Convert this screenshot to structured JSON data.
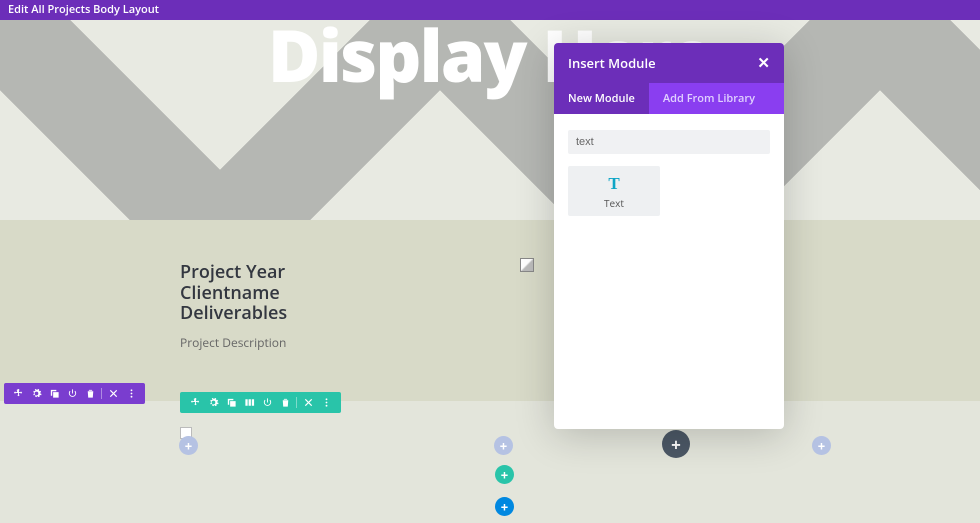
{
  "header": {
    "title": "Edit All Projects Body Layout"
  },
  "hero": {
    "title": "Display Here"
  },
  "info": {
    "line1": "Project Year",
    "line2": "Clientname",
    "line3": "Deliverables",
    "desc": "Project Description"
  },
  "modal": {
    "title": "Insert Module",
    "close": "✕",
    "tabs": {
      "new": "New Module",
      "lib": "Add From Library"
    },
    "search_value": "text",
    "module": {
      "icon": "T",
      "label": "Text"
    }
  },
  "plus": "+"
}
